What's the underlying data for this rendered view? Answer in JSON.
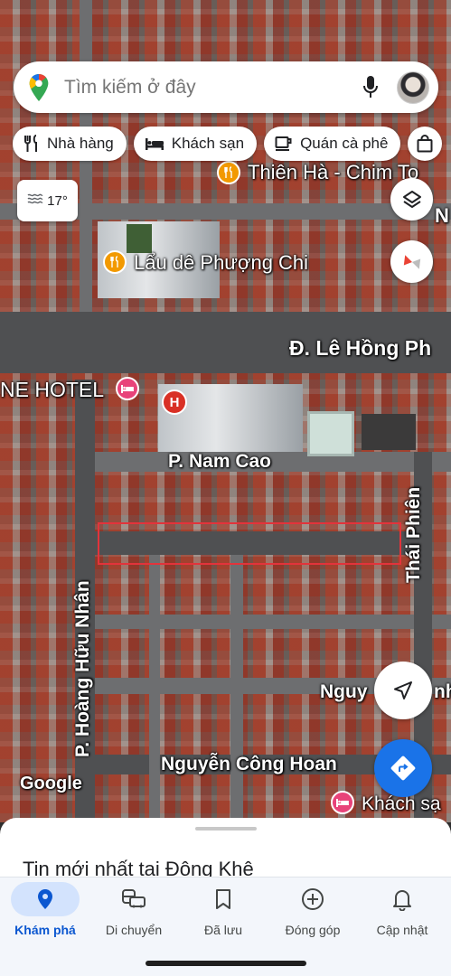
{
  "search": {
    "placeholder": "Tìm kiếm ở đây"
  },
  "chips": [
    {
      "label": "Nhà hàng",
      "icon": "restaurant-icon"
    },
    {
      "label": "Khách sạn",
      "icon": "hotel-icon"
    },
    {
      "label": "Quán cà phê",
      "icon": "coffee-icon"
    }
  ],
  "weather": {
    "temperature": "17°",
    "icon": "haze-icon"
  },
  "map_labels": {
    "thien_ha": "Thiên Hà - Chim To",
    "lau_de": "Lẩu dê Phượng Chi",
    "le_hong_phong": "Đ. Lê Hồng Ph",
    "hotel": "NE HOTEL",
    "nam_cao": "P. Nam Cao",
    "thai_phien": "Thái Phiên",
    "hoang_huu_nhan": "P. Hoàng Hữu Nhân",
    "nguyen_partial": "Nguy",
    "nguyen_partial_end": "nh",
    "nguyen_cong_hoan": "Nguyễn Công Hoan",
    "khach_san": "Khách sạ",
    "n_edge": "N",
    "google": "Google"
  },
  "sheet": {
    "heading": "Tin mới nhất tại Đông Khê"
  },
  "nav": [
    {
      "label": "Khám phá",
      "icon": "explore-pin-icon",
      "active": true
    },
    {
      "label": "Di chuyển",
      "icon": "commute-icon",
      "active": false
    },
    {
      "label": "Đã lưu",
      "icon": "bookmark-icon",
      "active": false
    },
    {
      "label": "Đóng góp",
      "icon": "add-circle-icon",
      "active": false
    },
    {
      "label": "Cập nhật",
      "icon": "bell-icon",
      "active": false
    }
  ],
  "colors": {
    "accent": "#1a73e8",
    "highlight": "#e3333b",
    "poi_orange": "#f29900",
    "poi_pink": "#e8437a",
    "hospital_red": "#d93025"
  }
}
